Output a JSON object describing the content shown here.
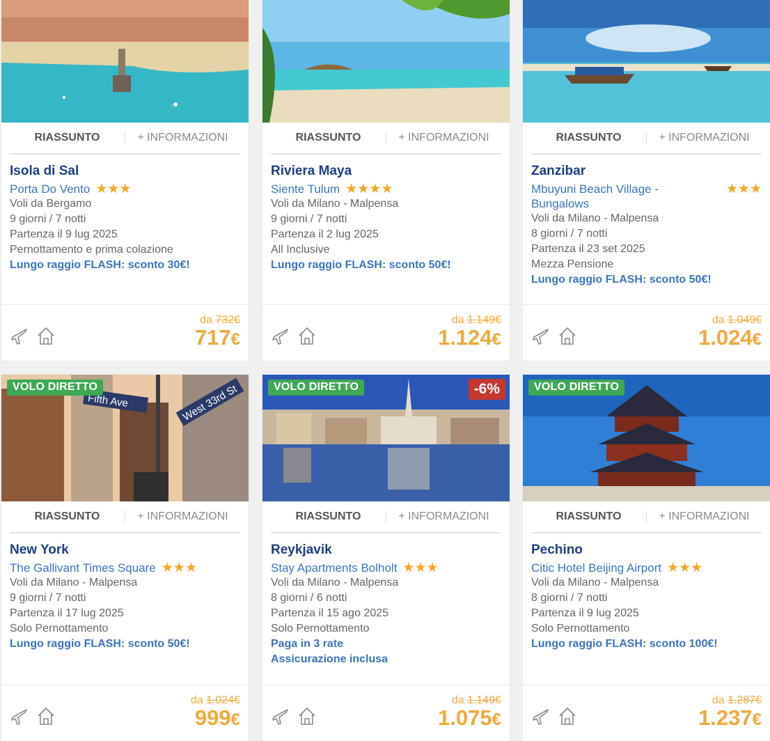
{
  "tabs": {
    "summary": "RIASSUNTO",
    "info": "+ INFORMAZIONI"
  },
  "badge_direct": "VOLO DIRETTO",
  "price_prefix": "da",
  "currency": "€",
  "colors": {
    "accent": "#f0a93c",
    "title": "#1e3f84",
    "link": "#3b74bd",
    "direct": "#3fa855",
    "discount": "#c6372f"
  },
  "cards": [
    {
      "destination": "Isola di Sal",
      "hotel": "Porta Do Vento",
      "stars": "★★★",
      "departure": "Voli da Bergamo",
      "duration": "9 giorni / 7 notti",
      "date": "Partenza il 9 lug 2025",
      "board": "Pernottamento e prima colazione",
      "promo1": "Lungo raggio FLASH: sconto 30€!",
      "old_price": "732€",
      "price": "717"
    },
    {
      "destination": "Riviera Maya",
      "hotel": "Siente Tulum",
      "stars": "★★★★",
      "departure": "Voli da Milano - Malpensa",
      "duration": "9 giorni / 7 notti",
      "date": "Partenza il 2 lug 2025",
      "board": "All Inclusive",
      "promo1": "Lungo raggio FLASH: sconto 50€!",
      "old_price": "1.149€",
      "price": "1.124"
    },
    {
      "destination": "Zanzibar",
      "hotel": "Mbuyuni Beach Village - Bungalows",
      "stars": "★★★",
      "departure": "Voli da Milano - Malpensa",
      "duration": "8 giorni / 7 notti",
      "date": "Partenza il 23 set 2025",
      "board": "Mezza Pensione",
      "promo1": "Lungo raggio FLASH: sconto 50€!",
      "old_price": "1.049€",
      "price": "1.024"
    },
    {
      "destination": "New York",
      "hotel": "The Gallivant Times Square",
      "stars": "★★★",
      "departure": "Voli da Milano - Malpensa",
      "duration": "9 giorni / 7 notti",
      "date": "Partenza il 17 lug 2025",
      "board": "Solo Pernottamento",
      "promo1": "Lungo raggio FLASH: sconto 50€!",
      "old_price": "1.024€",
      "price": "999",
      "image_text": {
        "sign1": "Fifth Ave",
        "sign2": "West 33rd St"
      }
    },
    {
      "destination": "Reykjavik",
      "hotel": "Stay Apartments Bolholt",
      "stars": "★★★",
      "departure": "Voli da Milano - Malpensa",
      "duration": "8 giorni / 6 notti",
      "date": "Partenza il 15 ago 2025",
      "board": "Solo Pernottamento",
      "promo1": "Paga in 3 rate",
      "promo2": "Assicurazione inclusa",
      "old_price": "1.149€",
      "price": "1.075",
      "discount": "-6%"
    },
    {
      "destination": "Pechino",
      "hotel": "Citic Hotel Beijing Airport",
      "stars": "★★★",
      "departure": "Voli da Milano - Malpensa",
      "duration": "8 giorni / 7 notti",
      "date": "Partenza il 9 lug 2025",
      "board": "Solo Pernottamento",
      "promo1": "Lungo raggio FLASH: sconto 100€!",
      "old_price": "1.287€",
      "price": "1.237"
    }
  ]
}
